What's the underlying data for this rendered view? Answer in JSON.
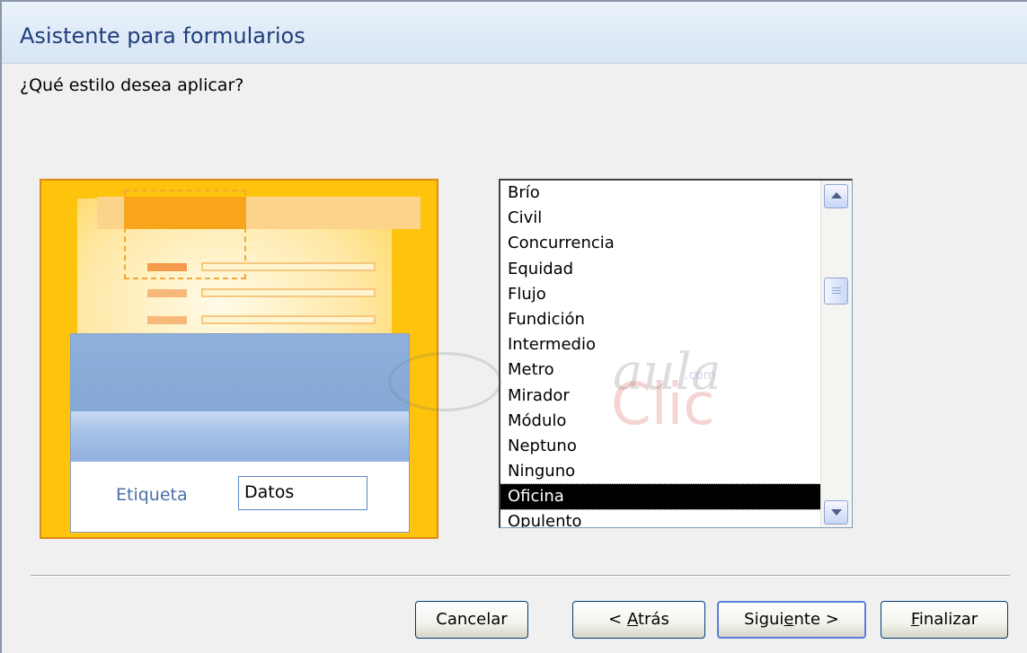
{
  "window": {
    "title": "Asistente para formularios"
  },
  "prompt": "¿Qué estilo desea aplicar?",
  "preview": {
    "label_text": "Etiqueta",
    "field_text": "Datos"
  },
  "styles_list": {
    "items": [
      "Brío",
      "Civil",
      "Concurrencia",
      "Equidad",
      "Flujo",
      "Fundición",
      "Intermedio",
      "Metro",
      "Mirador",
      "Módulo",
      "Neptuno",
      "Ninguno",
      "Oficina",
      "Opulento"
    ],
    "selected": "Oficina"
  },
  "watermark": {
    "top": "aula",
    "sub": ".com",
    "bottom": "Clic"
  },
  "buttons": {
    "cancel": "Cancelar",
    "back_prefix": "< ",
    "back_accel": "A",
    "back_rest": "trás",
    "next_prefix": "Sigui",
    "next_accel": "e",
    "next_rest": "nte >",
    "finish_accel": "F",
    "finish_rest": "inalizar"
  },
  "colors": {
    "preview_bg": "#fdc30d",
    "preview_border": "#e08a1a",
    "form_band": "#8fb0dc",
    "selection": "#000000",
    "title_text": "#1f3e7c"
  }
}
